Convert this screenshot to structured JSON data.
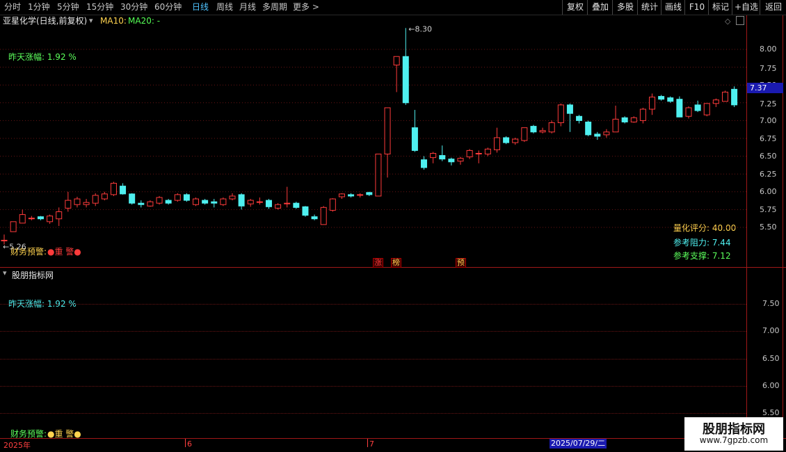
{
  "toolbar": {
    "periods": [
      "分时",
      "1分钟",
      "5分钟",
      "15分钟",
      "30分钟",
      "60分钟",
      "日线",
      "周线",
      "月线",
      "多周期",
      "更多 >"
    ],
    "active_period": "日线",
    "buttons": [
      "复权",
      "叠加",
      "多股",
      "统计",
      "画线",
      "F10",
      "标记",
      "+自选",
      "返回"
    ]
  },
  "main_pane": {
    "title": "亚星化学(日线,前复权)",
    "ma10": "MA10:",
    "ma20": "MA20: -",
    "zuotian": "昨天涨幅: 1.92 %",
    "high_label": "8.30",
    "low_label": "5.26",
    "current_price": "7.37",
    "alert_prefix": "财务预警:",
    "alert_text": "●重 警●",
    "tags": [
      "涨",
      "榜",
      "预"
    ],
    "quant_score": "量化评分: 40.00",
    "resistance": "参考阻力: 7.44",
    "support": "参考支撑: 7.12",
    "axis": [
      "8.00",
      "7.75",
      "7.50",
      "7.25",
      "7.00",
      "6.75",
      "6.50",
      "6.25",
      "6.00",
      "5.75",
      "5.50"
    ]
  },
  "sub_pane": {
    "title": "股朋指标网",
    "zuotian": "昨天涨幅: 1.92 %",
    "alert_prefix": "财务预警:",
    "alert_text": "●重 警●",
    "axis": [
      "7.50",
      "7.00",
      "6.50",
      "6.00",
      "5.50"
    ]
  },
  "time_axis": {
    "labels": [
      "2025年",
      "6",
      "7"
    ],
    "cursor": "2025/07/29/二"
  },
  "logo": {
    "line1": "股朋指标网",
    "line2": "www.7gpzb.com"
  },
  "colors": {
    "up": "#ff3b3b",
    "down": "#4ff0f0",
    "active": "#4fc3ff",
    "border": "#a01818"
  },
  "chart_data": {
    "type": "candlestick",
    "title": "亚星化学(日线,前复权)",
    "ylim": [
      5.2,
      8.45
    ],
    "note_month_starts": {
      "6": 14,
      "7": 34
    },
    "candles": [
      {
        "o": 5.32,
        "c": 5.32,
        "h": 5.4,
        "l": 5.26
      },
      {
        "o": 5.44,
        "c": 5.58,
        "h": 5.58,
        "l": 5.44
      },
      {
        "o": 5.56,
        "c": 5.68,
        "h": 5.75,
        "l": 5.56
      },
      {
        "o": 5.63,
        "c": 5.63,
        "h": 5.66,
        "l": 5.6
      },
      {
        "o": 5.65,
        "c": 5.62,
        "h": 5.66,
        "l": 5.6
      },
      {
        "o": 5.58,
        "c": 5.66,
        "h": 5.68,
        "l": 5.55
      },
      {
        "o": 5.62,
        "c": 5.72,
        "h": 5.78,
        "l": 5.52
      },
      {
        "o": 5.77,
        "c": 5.88,
        "h": 6.0,
        "l": 5.72
      },
      {
        "o": 5.82,
        "c": 5.9,
        "h": 5.93,
        "l": 5.78
      },
      {
        "o": 5.82,
        "c": 5.85,
        "h": 5.9,
        "l": 5.78
      },
      {
        "o": 5.84,
        "c": 5.95,
        "h": 5.98,
        "l": 5.8
      },
      {
        "o": 5.9,
        "c": 5.97,
        "h": 6.0,
        "l": 5.88
      },
      {
        "o": 5.96,
        "c": 6.12,
        "h": 6.14,
        "l": 5.94
      },
      {
        "o": 6.08,
        "c": 5.97,
        "h": 6.12,
        "l": 5.96
      },
      {
        "o": 5.97,
        "c": 5.84,
        "h": 5.98,
        "l": 5.82
      },
      {
        "o": 5.84,
        "c": 5.82,
        "h": 5.88,
        "l": 5.78
      },
      {
        "o": 5.8,
        "c": 5.86,
        "h": 5.88,
        "l": 5.79
      },
      {
        "o": 5.84,
        "c": 5.92,
        "h": 5.94,
        "l": 5.82
      },
      {
        "o": 5.88,
        "c": 5.84,
        "h": 5.9,
        "l": 5.82
      },
      {
        "o": 5.88,
        "c": 5.96,
        "h": 5.98,
        "l": 5.86
      },
      {
        "o": 5.96,
        "c": 5.88,
        "h": 5.98,
        "l": 5.86
      },
      {
        "o": 5.82,
        "c": 5.9,
        "h": 5.92,
        "l": 5.8
      },
      {
        "o": 5.88,
        "c": 5.84,
        "h": 5.9,
        "l": 5.82
      },
      {
        "o": 5.86,
        "c": 5.84,
        "h": 5.9,
        "l": 5.78
      },
      {
        "o": 5.82,
        "c": 5.9,
        "h": 5.92,
        "l": 5.8
      },
      {
        "o": 5.9,
        "c": 5.94,
        "h": 5.98,
        "l": 5.88
      },
      {
        "o": 5.96,
        "c": 5.8,
        "h": 5.98,
        "l": 5.75
      },
      {
        "o": 5.83,
        "c": 5.88,
        "h": 5.9,
        "l": 5.79
      },
      {
        "o": 5.86,
        "c": 5.86,
        "h": 5.92,
        "l": 5.82
      },
      {
        "o": 5.88,
        "c": 5.79,
        "h": 5.9,
        "l": 5.76
      },
      {
        "o": 5.77,
        "c": 5.82,
        "h": 5.84,
        "l": 5.75
      },
      {
        "o": 5.84,
        "c": 5.84,
        "h": 6.07,
        "l": 5.78
      },
      {
        "o": 5.84,
        "c": 5.78,
        "h": 5.86,
        "l": 5.76
      },
      {
        "o": 5.79,
        "c": 5.67,
        "h": 5.8,
        "l": 5.65
      },
      {
        "o": 5.65,
        "c": 5.62,
        "h": 5.68,
        "l": 5.6
      },
      {
        "o": 5.54,
        "c": 5.78,
        "h": 5.8,
        "l": 5.54
      },
      {
        "o": 5.74,
        "c": 5.9,
        "h": 5.91,
        "l": 5.72
      },
      {
        "o": 5.93,
        "c": 5.97,
        "h": 5.98,
        "l": 5.9
      },
      {
        "o": 5.96,
        "c": 5.94,
        "h": 5.98,
        "l": 5.92
      },
      {
        "o": 5.96,
        "c": 5.96,
        "h": 5.98,
        "l": 5.92
      },
      {
        "o": 5.99,
        "c": 5.96,
        "h": 6.0,
        "l": 5.94
      },
      {
        "o": 5.94,
        "c": 6.53,
        "h": 6.53,
        "l": 5.94
      },
      {
        "o": 6.53,
        "c": 7.18,
        "h": 7.18,
        "l": 6.2
      },
      {
        "o": 7.78,
        "c": 7.9,
        "h": 7.9,
        "l": 7.4
      },
      {
        "o": 7.9,
        "c": 7.25,
        "h": 8.3,
        "l": 7.22
      },
      {
        "o": 6.9,
        "c": 6.58,
        "h": 7.15,
        "l": 6.56
      },
      {
        "o": 6.45,
        "c": 6.34,
        "h": 6.5,
        "l": 6.31
      },
      {
        "o": 6.48,
        "c": 6.54,
        "h": 6.56,
        "l": 6.4
      },
      {
        "o": 6.51,
        "c": 6.46,
        "h": 6.65,
        "l": 6.43
      },
      {
        "o": 6.46,
        "c": 6.42,
        "h": 6.48,
        "l": 6.37
      },
      {
        "o": 6.43,
        "c": 6.47,
        "h": 6.49,
        "l": 6.38
      },
      {
        "o": 6.49,
        "c": 6.58,
        "h": 6.6,
        "l": 6.46
      },
      {
        "o": 6.54,
        "c": 6.54,
        "h": 6.58,
        "l": 6.4
      },
      {
        "o": 6.53,
        "c": 6.6,
        "h": 6.62,
        "l": 6.5
      },
      {
        "o": 6.59,
        "c": 6.76,
        "h": 6.9,
        "l": 6.55
      },
      {
        "o": 6.76,
        "c": 6.69,
        "h": 6.78,
        "l": 6.67
      },
      {
        "o": 6.69,
        "c": 6.74,
        "h": 6.76,
        "l": 6.66
      },
      {
        "o": 6.72,
        "c": 6.9,
        "h": 6.9,
        "l": 6.7
      },
      {
        "o": 6.92,
        "c": 6.84,
        "h": 6.94,
        "l": 6.82
      },
      {
        "o": 6.84,
        "c": 6.86,
        "h": 6.9,
        "l": 6.82
      },
      {
        "o": 6.84,
        "c": 6.97,
        "h": 7.0,
        "l": 6.82
      },
      {
        "o": 6.97,
        "c": 7.22,
        "h": 7.24,
        "l": 6.92
      },
      {
        "o": 7.22,
        "c": 7.1,
        "h": 7.24,
        "l": 6.84
      },
      {
        "o": 7.06,
        "c": 7.0,
        "h": 7.08,
        "l": 6.96
      },
      {
        "o": 6.98,
        "c": 6.8,
        "h": 7.0,
        "l": 6.78
      },
      {
        "o": 6.81,
        "c": 6.78,
        "h": 6.84,
        "l": 6.73
      },
      {
        "o": 6.8,
        "c": 6.84,
        "h": 6.88,
        "l": 6.76
      },
      {
        "o": 6.84,
        "c": 7.02,
        "h": 7.21,
        "l": 6.84
      },
      {
        "o": 7.04,
        "c": 6.98,
        "h": 7.06,
        "l": 6.96
      },
      {
        "o": 6.98,
        "c": 7.04,
        "h": 7.06,
        "l": 6.97
      },
      {
        "o": 7.0,
        "c": 7.16,
        "h": 7.18,
        "l": 6.96
      },
      {
        "o": 7.16,
        "c": 7.33,
        "h": 7.38,
        "l": 7.08
      },
      {
        "o": 7.34,
        "c": 7.3,
        "h": 7.36,
        "l": 7.28
      },
      {
        "o": 7.32,
        "c": 7.27,
        "h": 7.34,
        "l": 7.25
      },
      {
        "o": 7.3,
        "c": 7.05,
        "h": 7.34,
        "l": 7.05
      },
      {
        "o": 7.06,
        "c": 7.18,
        "h": 7.2,
        "l": 7.03
      },
      {
        "o": 7.22,
        "c": 7.14,
        "h": 7.28,
        "l": 7.12
      },
      {
        "o": 7.08,
        "c": 7.24,
        "h": 7.24,
        "l": 7.06
      },
      {
        "o": 7.24,
        "c": 7.29,
        "h": 7.31,
        "l": 7.19
      },
      {
        "o": 7.27,
        "c": 7.4,
        "h": 7.42,
        "l": 7.27
      },
      {
        "o": 7.44,
        "c": 7.22,
        "h": 7.48,
        "l": 7.19
      }
    ]
  }
}
